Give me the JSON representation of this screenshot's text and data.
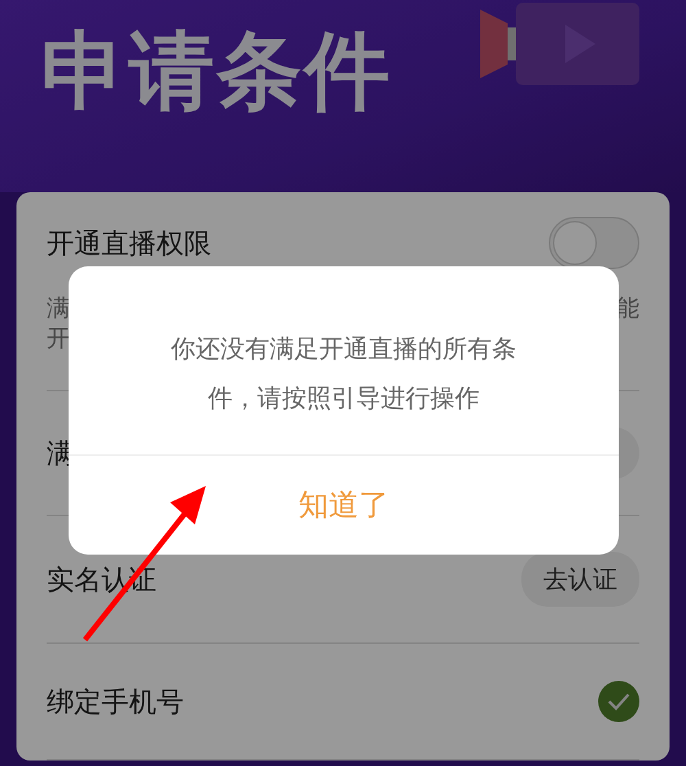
{
  "header": {
    "title": "申请条件"
  },
  "rows": [
    {
      "kind": "toggle",
      "label": "开通直播权限",
      "on": false,
      "description": [
        {
          "left": "满",
          "right": "能"
        },
        {
          "left": "开"
        }
      ]
    },
    {
      "kind": "button",
      "label": "满"
    },
    {
      "kind": "button",
      "label": "实名认证",
      "button": "去认证"
    },
    {
      "kind": "check",
      "label": "绑定手机号",
      "checked": true
    }
  ],
  "dialog": {
    "message": "你还没有满足开通直播的所有条件，请按照引导进行操作",
    "button": "知道了"
  }
}
